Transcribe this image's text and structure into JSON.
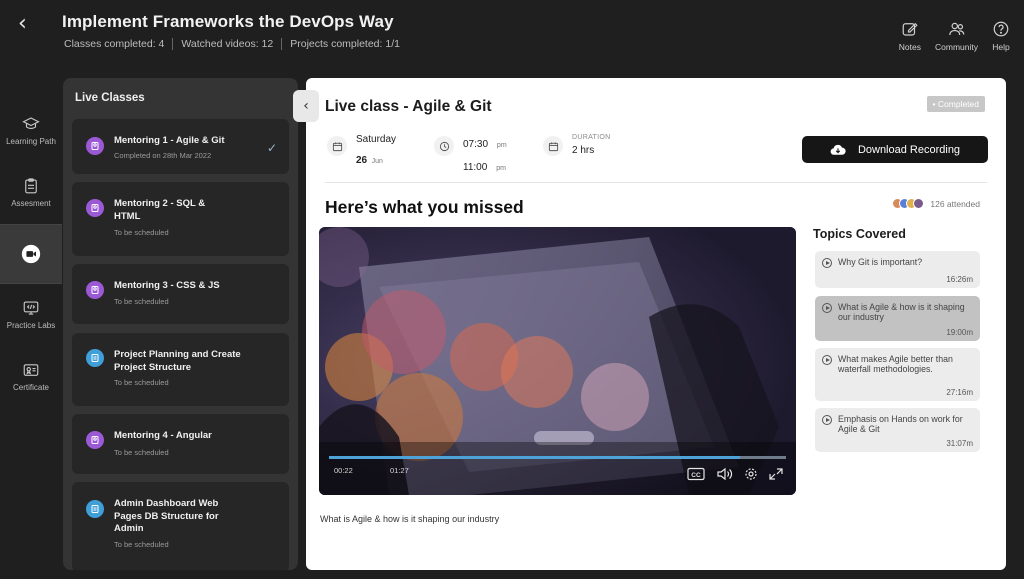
{
  "header": {
    "back_icon": "chevron-left-icon",
    "title": "Implement Frameworks the DevOps Way",
    "stats": [
      "Classes completed: 4",
      "Watched videos: 12",
      "Projects completed: 1/1"
    ],
    "actions": [
      {
        "label": "Notes",
        "icon": "edit-icon"
      },
      {
        "label": "Community",
        "icon": "people-icon"
      },
      {
        "label": "Help",
        "icon": "help-icon"
      }
    ]
  },
  "rail": [
    {
      "label": "Learning Path",
      "icon": "graduation-cap-icon"
    },
    {
      "label": "Assesment",
      "icon": "clipboard-icon"
    },
    {
      "label": "",
      "icon": "video-camera-icon",
      "active": true
    },
    {
      "label": "Practice Labs",
      "icon": "code-monitor-icon"
    },
    {
      "label": "Certificate",
      "icon": "certificate-icon"
    }
  ],
  "panel": {
    "title": "Live Classes",
    "classes": [
      {
        "name": "Mentoring 1 - Agile & Git",
        "status": "Completed on 28th Mar 2022",
        "kind": "mentoring",
        "done": true
      },
      {
        "name": "Mentoring 2 - SQL & HTML",
        "status": "To be scheduled",
        "kind": "mentoring"
      },
      {
        "name": "Mentoring 3 - CSS & JS",
        "status": "To be scheduled",
        "kind": "mentoring"
      },
      {
        "name": "Project Planning and Create Project Structure",
        "status": "To be scheduled",
        "kind": "project"
      },
      {
        "name": "Mentoring 4 - Angular",
        "status": "To be scheduled",
        "kind": "mentoring"
      },
      {
        "name": "Admin Dashboard Web Pages DB Structure for Admin",
        "status": "To be scheduled",
        "kind": "project"
      }
    ]
  },
  "main": {
    "title": "Live class - Agile & Git",
    "badge": "Completed",
    "day": "Saturday",
    "date_num": "26",
    "date_month": "Jun",
    "start_time": "07:30",
    "start_period": "pm",
    "end_time": "11:00",
    "end_period": "pm",
    "duration_label": "DURATION",
    "duration_value": "2 hrs",
    "download_label": "Download Recording",
    "missed_title": "Here’s what you missed",
    "attended": "126 attended",
    "video": {
      "current_time": "00:22",
      "duration": "01:27",
      "progress": 0.9
    },
    "caption": "What is Agile & how is it shaping our industry"
  },
  "topics": {
    "title": "Topics Covered",
    "items": [
      {
        "name": "Why Git is important?",
        "duration": "16:26m"
      },
      {
        "name": "What is Agile & how is it shaping our industry",
        "duration": "19:00m",
        "active": true
      },
      {
        "name": "What makes Agile better than waterfall methodologies.",
        "duration": "27:16m"
      },
      {
        "name": "Emphasis on Hands on work for Agile & Git",
        "duration": "31:07m"
      }
    ]
  },
  "colors": {
    "mentoring_icon": "#9b59d6",
    "project_icon": "#3f9fd8",
    "progress": "#4da3d8"
  }
}
